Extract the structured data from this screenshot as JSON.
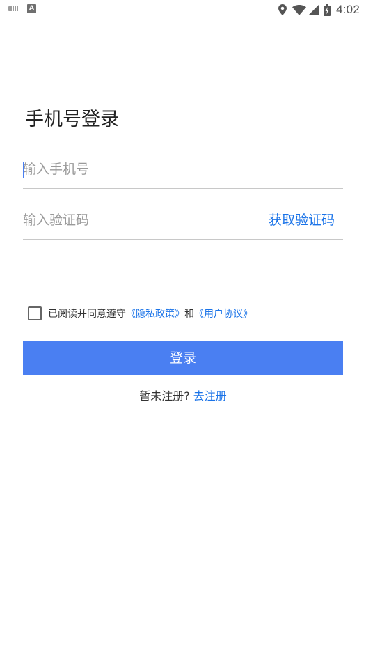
{
  "status_bar": {
    "time": "4:02",
    "left_badge": "A",
    "icons": [
      "keyboard-icon",
      "a-badge-icon",
      "location-icon",
      "wifi-icon",
      "signal-icon",
      "battery-icon"
    ]
  },
  "login": {
    "title": "手机号登录",
    "phone_placeholder": "输入手机号",
    "phone_value": "",
    "code_placeholder": "输入验证码",
    "code_value": "",
    "get_code": "获取验证码"
  },
  "agreement": {
    "checked": false,
    "prefix": "已阅读并同意遵守",
    "privacy_link": "《隐私政策》",
    "conjunction": "和",
    "terms_link": "《用户协议》"
  },
  "actions": {
    "login_button": "登录",
    "register_prompt": "暂未注册?",
    "register_link": "去注册"
  },
  "colors": {
    "primary": "#4a7ff2",
    "link": "#1a73e8",
    "placeholder": "#9a9a9a",
    "divider": "#c8c8c8"
  }
}
